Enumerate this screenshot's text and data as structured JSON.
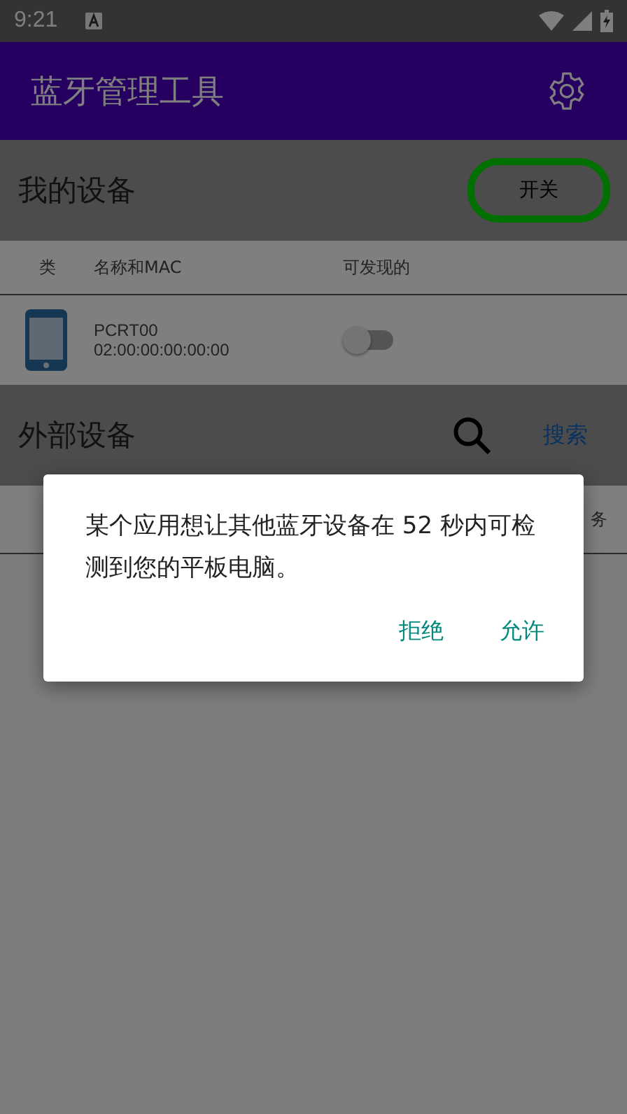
{
  "status_bar": {
    "time": "9:21"
  },
  "app_bar": {
    "title": "蓝牙管理工具"
  },
  "my_devices": {
    "title": "我的设备",
    "toggle_button": "开关",
    "columns": [
      "类",
      "名称和MAC",
      "可发现的"
    ],
    "rows": [
      {
        "name": "PCRT00",
        "mac": "02:00:00:00:00:00",
        "discoverable": false
      }
    ]
  },
  "external_devices": {
    "title": "外部设备",
    "search_button": "搜索",
    "columns_visible": [
      "务"
    ]
  },
  "dialog": {
    "message": "某个应用想让其他蓝牙设备在 52 秒内可检测到您的平板电脑。",
    "buttons": [
      "拒绝",
      "允许"
    ]
  }
}
